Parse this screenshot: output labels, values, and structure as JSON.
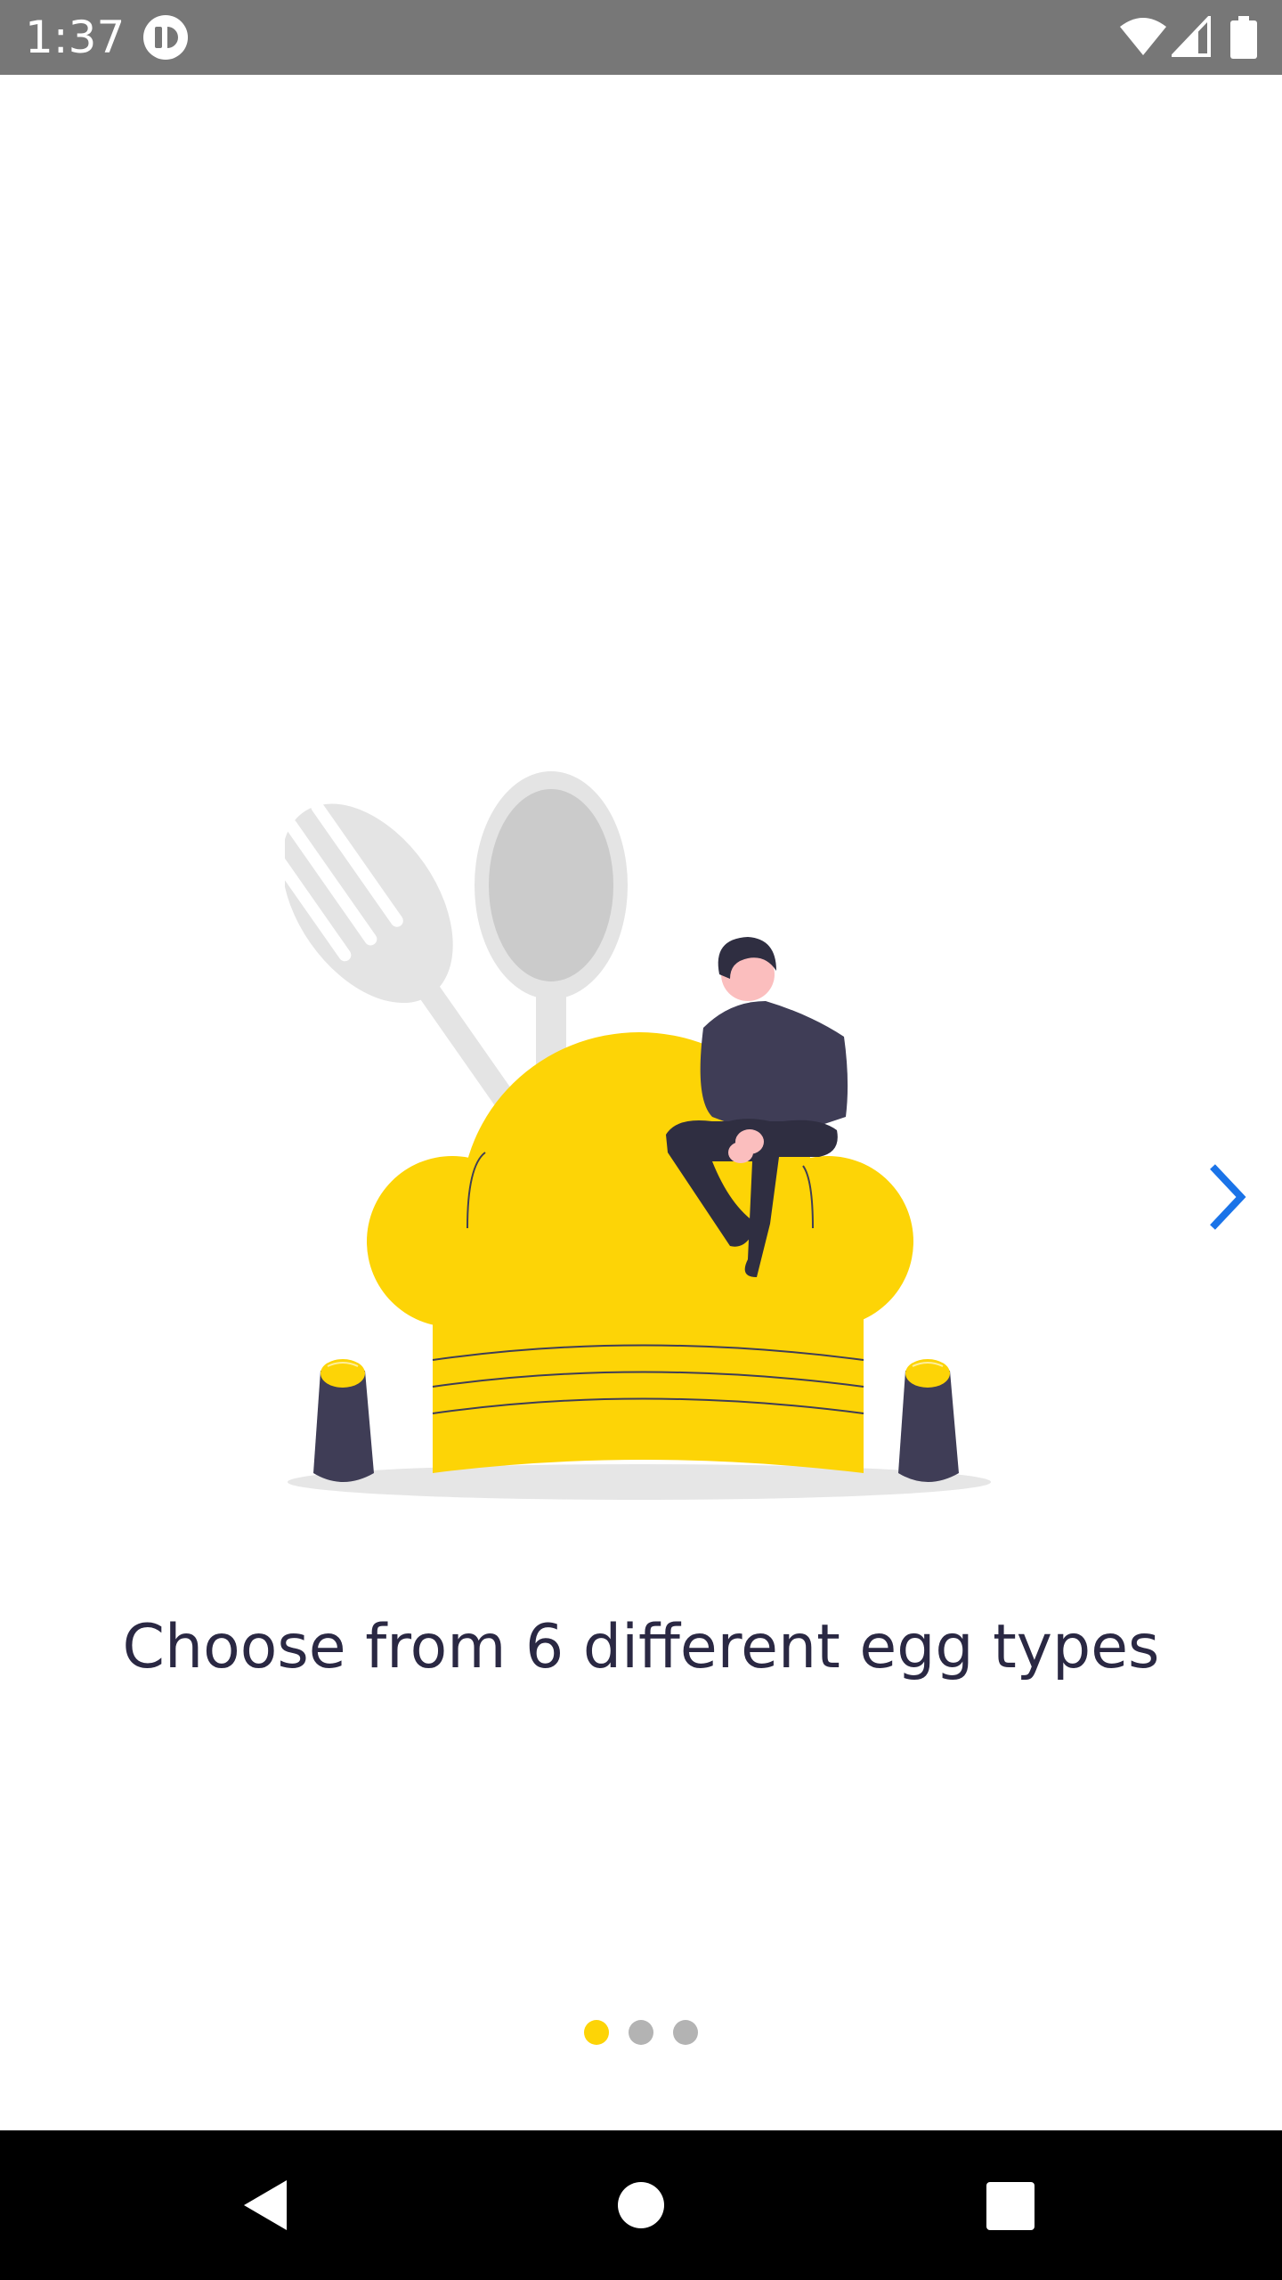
{
  "status_bar": {
    "time": "1:37",
    "icons": [
      "app-notification-icon",
      "wifi-icon",
      "cell-signal-icon",
      "battery-icon"
    ]
  },
  "onboarding": {
    "title": "Choose from 6 different egg types",
    "next_icon": "chevron-right-icon",
    "pager": {
      "total": 3,
      "active_index": 0
    }
  },
  "nav_bar": {
    "icons": [
      "back-icon",
      "home-icon",
      "recents-icon"
    ]
  },
  "colors": {
    "status_bar": "#777777",
    "accent_yellow": "#fdd406",
    "figure_dark": "#3f3d56",
    "link_blue": "#1a73e8",
    "dot_inactive": "#b3b3b3",
    "title_text": "#2a2843"
  }
}
